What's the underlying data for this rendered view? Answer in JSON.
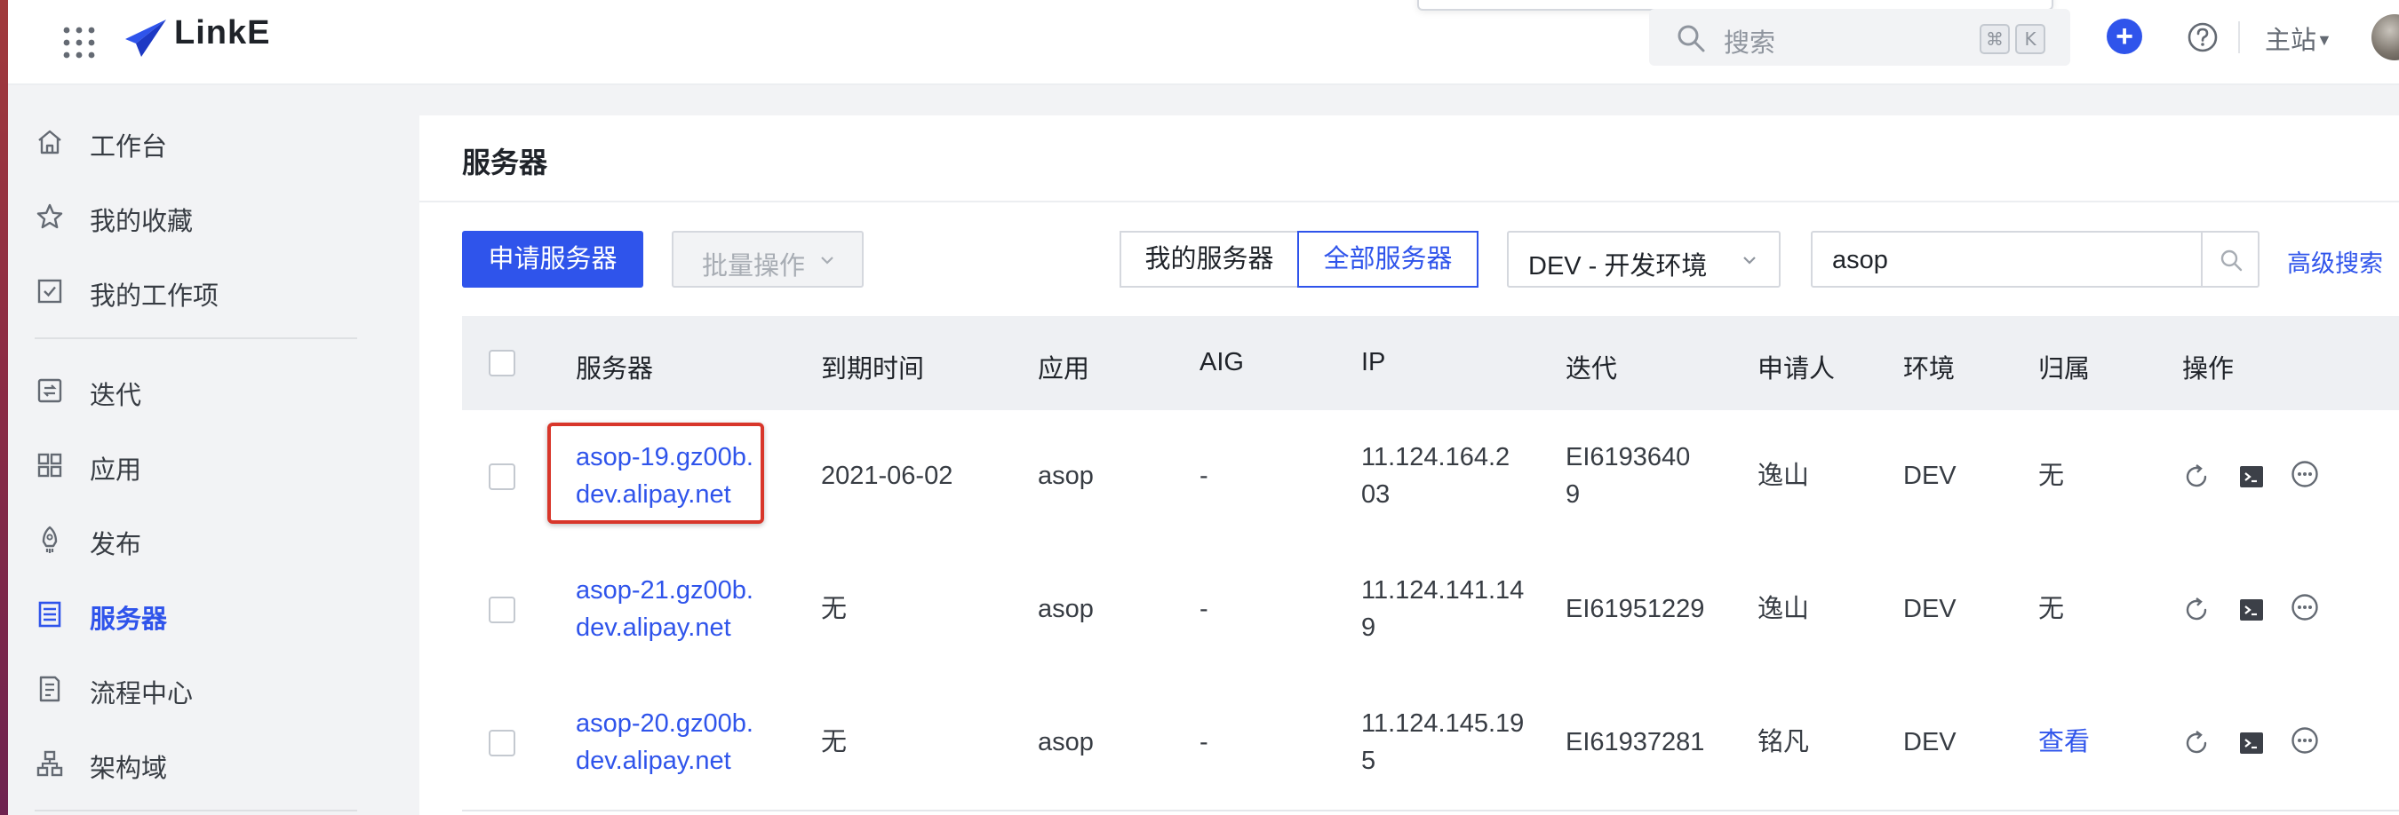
{
  "app": {
    "name": "LinkE"
  },
  "topbar": {
    "search_placeholder": "搜索",
    "shortcut_keys": [
      "⌘",
      "K"
    ],
    "site_menu": "主站",
    "accent": "#2f54eb"
  },
  "sidebar": {
    "items": [
      {
        "label": "工作台",
        "icon": "home-icon"
      },
      {
        "label": "我的收藏",
        "icon": "star-icon"
      },
      {
        "label": "我的工作项",
        "icon": "checklist-icon"
      },
      {
        "label": "迭代",
        "icon": "iteration-icon"
      },
      {
        "label": "应用",
        "icon": "apps-grid-icon"
      },
      {
        "label": "发布",
        "icon": "rocket-icon"
      },
      {
        "label": "服务器",
        "icon": "server-icon",
        "active": true
      },
      {
        "label": "流程中心",
        "icon": "process-icon"
      },
      {
        "label": "架构域",
        "icon": "architecture-icon"
      }
    ]
  },
  "page": {
    "title": "服务器",
    "apply_button": "申请服务器",
    "batch_button": "批量操作",
    "segment": {
      "mine": "我的服务器",
      "all": "全部服务器",
      "selected": "all"
    },
    "env_select": "DEV - 开发环境",
    "search_value": "asop",
    "advanced_search": "高级搜索"
  },
  "table": {
    "headers": [
      "服务器",
      "到期时间",
      "应用",
      "AIG",
      "IP",
      "迭代",
      "申请人",
      "环境",
      "归属",
      "操作"
    ],
    "rows": [
      {
        "server_line1": "asop-19.gz00b.",
        "server_line2": "dev.alipay.net",
        "expire": "2021-06-02",
        "app": "asop",
        "aig": "-",
        "ip_line1": "11.124.164.2",
        "ip_line2": "03",
        "iter_line1": "EI6193640",
        "iter_line2": "9",
        "applicant": "逸山",
        "env": "DEV",
        "owner": "无",
        "owner_is_link": false,
        "highlighted": true
      },
      {
        "server_line1": "asop-21.gz00b.",
        "server_line2": "dev.alipay.net",
        "expire": "无",
        "app": "asop",
        "aig": "-",
        "ip_line1": "11.124.141.14",
        "ip_line2": "9",
        "iter_line1": "EI61951229",
        "iter_line2": "",
        "applicant": "逸山",
        "env": "DEV",
        "owner": "无",
        "owner_is_link": false,
        "highlighted": false
      },
      {
        "server_line1": "asop-20.gz00b.",
        "server_line2": "dev.alipay.net",
        "expire": "无",
        "app": "asop",
        "aig": "-",
        "ip_line1": "11.124.145.19",
        "ip_line2": "5",
        "iter_line1": "EI61937281",
        "iter_line2": "",
        "applicant": "铭凡",
        "env": "DEV",
        "owner": "查看",
        "owner_is_link": true,
        "highlighted": false
      }
    ],
    "row_actions": [
      "refresh-icon",
      "terminal-icon",
      "more-icon"
    ]
  }
}
